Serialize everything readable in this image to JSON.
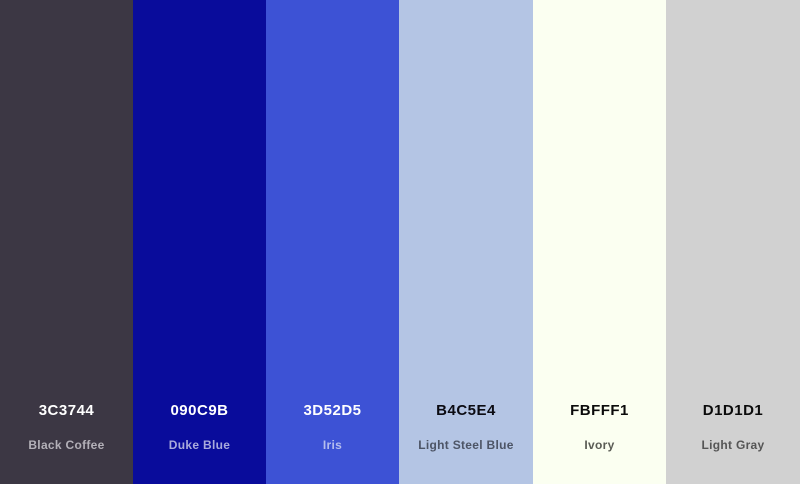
{
  "palette": {
    "swatches": [
      {
        "hex": "3C3744",
        "name": "Black Coffee",
        "color": "#3C3744",
        "hex_text_color": "#ffffff",
        "name_text_color": "#b3b0b8"
      },
      {
        "hex": "090C9B",
        "name": "Duke Blue",
        "color": "#090C9B",
        "hex_text_color": "#ffffff",
        "name_text_color": "#a9abdc"
      },
      {
        "hex": "3D52D5",
        "name": "Iris",
        "color": "#3D52D5",
        "hex_text_color": "#ffffff",
        "name_text_color": "#b5bdee"
      },
      {
        "hex": "B4C5E4",
        "name": "Light Steel Blue",
        "color": "#B4C5E4",
        "hex_text_color": "#0b0b12",
        "name_text_color": "#4d5566"
      },
      {
        "hex": "FBFFF1",
        "name": "Ivory",
        "color": "#FBFFF1",
        "hex_text_color": "#0b0b0b",
        "name_text_color": "#5a5c55"
      },
      {
        "hex": "D1D1D1",
        "name": "Light Gray",
        "color": "#D1D1D1",
        "hex_text_color": "#0b0b0b",
        "name_text_color": "#555555"
      }
    ]
  }
}
